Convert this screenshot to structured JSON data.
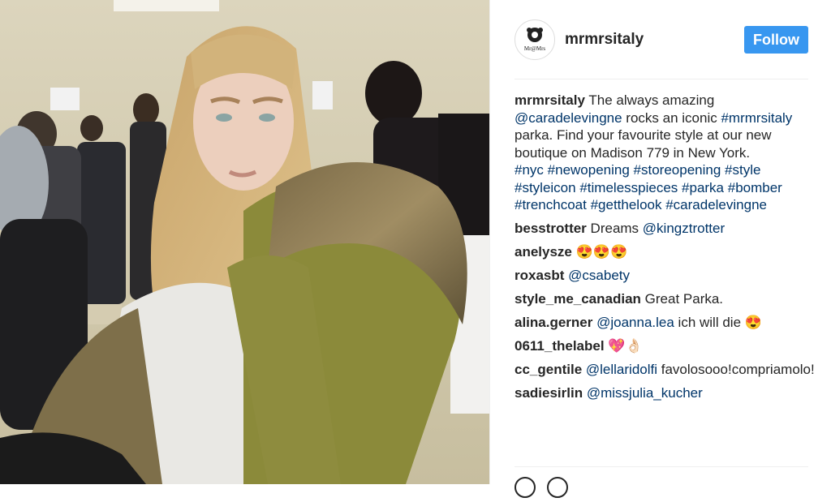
{
  "post": {
    "username": "mrmrsitaly",
    "follow_label": "Follow",
    "caption_user": "mrmrsitaly",
    "caption_parts": {
      "t1": " The always amazing ",
      "mention": "@caradelevingne",
      "t2": " rocks an iconic ",
      "tag": "#mrmrsitaly",
      "t3": " parka. Find your favourite style at our new boutique on Madison 779 in New York."
    },
    "caption_hashtags": [
      "#nyc",
      "#newopening",
      "#storeopening",
      "#style",
      "#styleicon",
      "#timelesspieces",
      "#parka",
      "#bomber",
      "#trenchcoat",
      "#getthelook",
      "#caradelevingne"
    ]
  },
  "comments": [
    {
      "user": "besstrotter",
      "text": "Dreams ",
      "mention": "@kingztrotter",
      "emoji": ""
    },
    {
      "user": "anelysze",
      "text": "",
      "mention": "",
      "emoji": "😍😍😍"
    },
    {
      "user": "roxasbt",
      "text": "",
      "mention": "@csabety",
      "emoji": ""
    },
    {
      "user": "style_me_canadian",
      "text": "Great Parka.",
      "mention": "",
      "emoji": ""
    },
    {
      "user": "alina.gerner",
      "text": "",
      "mention": "@joanna.lea",
      "after": " ich will die ",
      "emoji": "😍"
    },
    {
      "user": "0611_thelabel",
      "text": "",
      "mention": "",
      "emoji": "💖👌🏻"
    },
    {
      "user": "cc_gentile",
      "text": "",
      "mention": "@lellaridolfi",
      "after": " favolosooo!compriamolo!",
      "emoji": ""
    },
    {
      "user": "sadiesirlin",
      "text": "",
      "mention": "@missjulia_kucher",
      "emoji": ""
    }
  ],
  "icons": [
    "heart-icon",
    "comment-icon",
    "logo-icon"
  ],
  "colors": {
    "follow": "#3897f0",
    "link": "#003569",
    "text": "#262626"
  }
}
